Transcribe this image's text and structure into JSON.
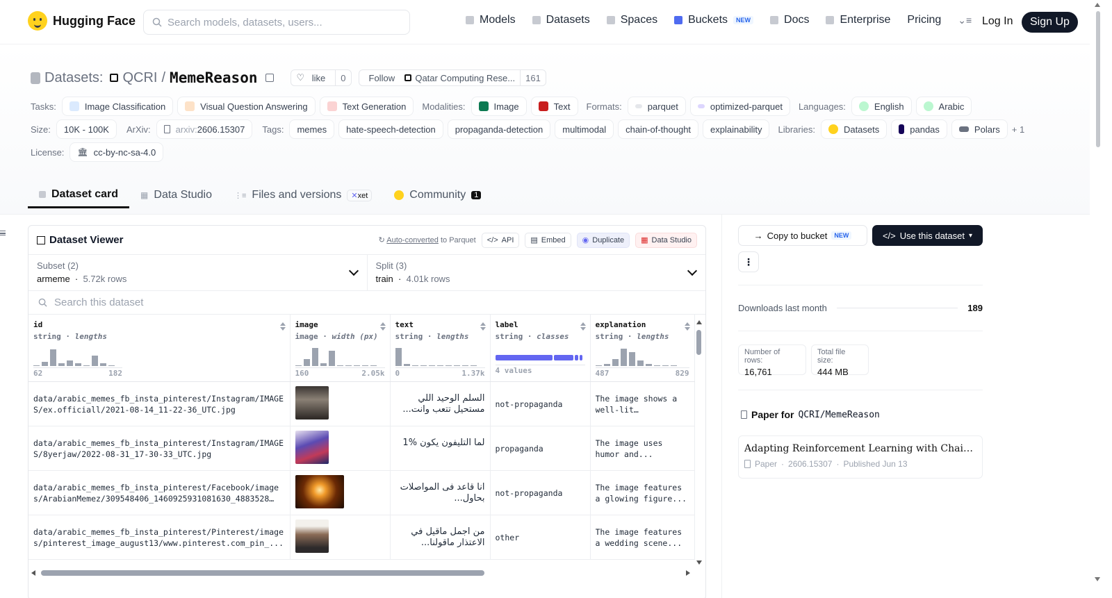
{
  "nav": {
    "brand": "Hugging Face",
    "search_placeholder": "Search models, datasets, users...",
    "links": [
      "Models",
      "Datasets",
      "Spaces",
      "Buckets",
      "Docs",
      "Enterprise",
      "Pricing"
    ],
    "buckets_badge": "NEW",
    "login": "Log In",
    "signup": "Sign Up"
  },
  "header": {
    "prefix": "Datasets:",
    "org": "QCRI",
    "sep": "/",
    "name": "MemeReason",
    "like_label": "like",
    "like_count": "0",
    "follow_label": "Follow",
    "follow_org": "Qatar Computing Rese...",
    "follow_count": "161"
  },
  "tags": {
    "tasks_label": "Tasks:",
    "tasks": [
      "Image Classification",
      "Visual Question Answering",
      "Text Generation"
    ],
    "modalities_label": "Modalities:",
    "modalities": [
      "Image",
      "Text"
    ],
    "formats_label": "Formats:",
    "formats": [
      "parquet",
      "optimized-parquet"
    ],
    "languages_label": "Languages:",
    "languages": [
      "English",
      "Arabic"
    ],
    "size_label": "Size:",
    "size": "10K - 100K",
    "arxiv_label": "ArXiv:",
    "arxiv_prefix": "arxiv:",
    "arxiv_id": "2606.15307",
    "tags_label": "Tags:",
    "tag_list": [
      "memes",
      "hate-speech-detection",
      "propaganda-detection",
      "multimodal",
      "chain-of-thought",
      "explainability"
    ],
    "libraries_label": "Libraries:",
    "libraries": [
      "Datasets",
      "pandas",
      "Polars"
    ],
    "libraries_more": "+ 1",
    "license_label": "License:",
    "license": "cc-by-nc-sa-4.0"
  },
  "tabs": {
    "dataset_card": "Dataset card",
    "data_studio": "Data Studio",
    "files": "Files and versions",
    "xet": "xet",
    "community": "Community",
    "community_count": "1"
  },
  "viewer": {
    "title": "Dataset Viewer",
    "auto_converted": "Auto-converted",
    "to_parquet": "to Parquet",
    "api": "API",
    "embed": "Embed",
    "duplicate": "Duplicate",
    "data_studio": "Data Studio",
    "subset_label": "Subset (2)",
    "subset_value": "armeme",
    "subset_rows": "5.72k rows",
    "split_label": "Split (3)",
    "split_value": "train",
    "split_rows": "4.01k rows",
    "search_placeholder": "Search this dataset",
    "columns": [
      {
        "name": "id",
        "type": "string",
        "stat": "lengths",
        "min": "62",
        "max": "182"
      },
      {
        "name": "image",
        "type": "image",
        "stat": "width (px)",
        "min": "160",
        "max": "2.05k"
      },
      {
        "name": "text",
        "type": "string",
        "stat": "lengths",
        "min": "0",
        "max": "1.37k"
      },
      {
        "name": "label",
        "type": "string",
        "stat": "classes",
        "min": "4 values",
        "max": ""
      },
      {
        "name": "explanation",
        "type": "string",
        "stat": "lengths",
        "min": "487",
        "max": "829"
      }
    ],
    "rows": [
      {
        "id": "data/arabic_memes_fb_insta_pinterest/Instagram/IMAGES/ex.officiall/2021-08-14_11-22-36_UTC.jpg",
        "text": "السلم الوحيد اللي مستحيل تتعب وانت...",
        "label": "not-propaganda",
        "explanation": "The image shows a well-lit airplane..."
      },
      {
        "id": "data/arabic_memes_fb_insta_pinterest/Instagram/IMAGES/8yerjaw/2022-08-31_17-30-33_UTC.jpg",
        "text": "لما التليفون يكون %1",
        "label": "propaganda",
        "explanation": "The image uses humor and..."
      },
      {
        "id": "data/arabic_memes_fb_insta_pinterest/Facebook/images/ArabianMemez/309548406_1460925931081630_48835288...",
        "text": "انا قاعد فى المواصلات بحاول...",
        "label": "not-propaganda",
        "explanation": "The image features a glowing figure..."
      },
      {
        "id": "data/arabic_memes_fb_insta_pinterest/Pinterest/images/pinterest_image_august13/www.pinterest.com_pin_...",
        "text": "من اجمل ماقيل في الاعتذار ماقولنا...",
        "label": "other",
        "explanation": "The image features a wedding scene..."
      }
    ]
  },
  "sidebar": {
    "copy_to_bucket": "Copy to bucket",
    "copy_badge": "NEW",
    "use_dataset": "Use this dataset",
    "downloads_label": "Downloads last month",
    "downloads": "189",
    "rows_label": "Number of rows:",
    "rows_value": "16,761",
    "size_label": "Total file size:",
    "size_value": "444 MB",
    "paper_for": "Paper for",
    "paper_repo": "QCRI/MemeReason",
    "paper_title": "Adapting Reinforcement Learning with Chain-of-Thought",
    "paper_kind": "Paper",
    "paper_id": "2606.15307",
    "paper_published": "Published Jun 13"
  }
}
